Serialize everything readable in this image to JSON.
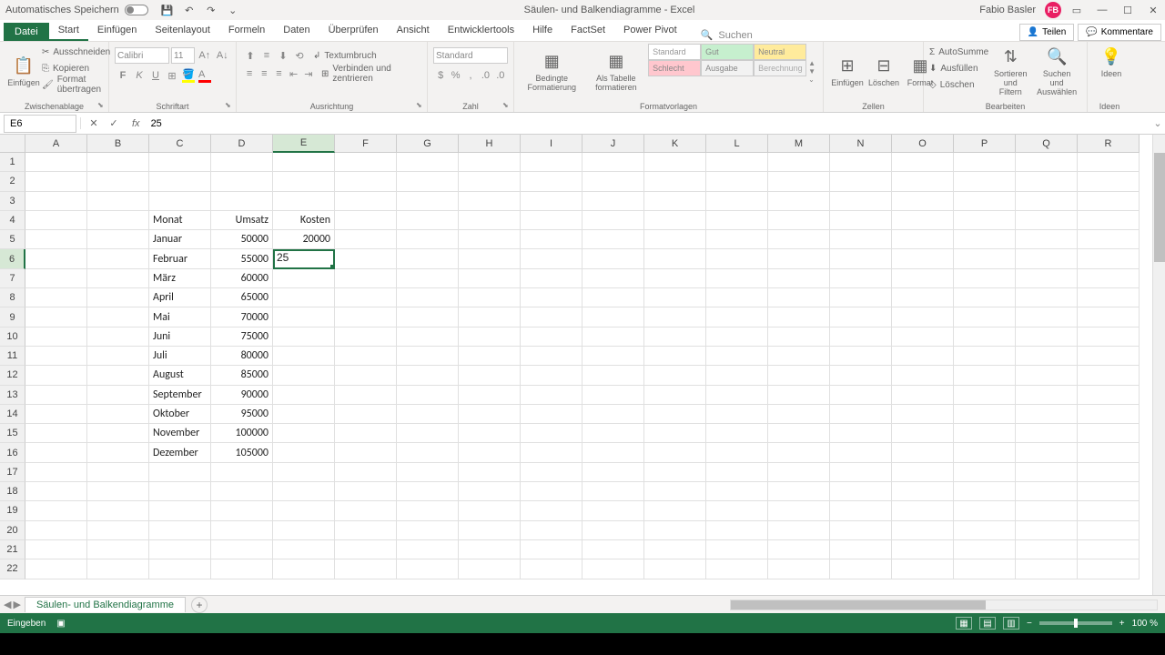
{
  "titlebar": {
    "autosave": "Automatisches Speichern",
    "doc_title": "Säulen- und Balkendiagramme - Excel",
    "user_name": "Fabio Basler",
    "user_initials": "FB"
  },
  "tabs": {
    "file": "Datei",
    "items": [
      "Start",
      "Einfügen",
      "Seitenlayout",
      "Formeln",
      "Daten",
      "Überprüfen",
      "Ansicht",
      "Entwicklertools",
      "Hilfe",
      "FactSet",
      "Power Pivot"
    ],
    "search_placeholder": "Suchen",
    "share": "Teilen",
    "comments": "Kommentare"
  },
  "ribbon": {
    "paste": "Einfügen",
    "cut": "Ausschneiden",
    "copy": "Kopieren",
    "format_painter": "Format übertragen",
    "clipboard": "Zwischenablage",
    "font_name": "Calibri",
    "font_size": "11",
    "font_group": "Schriftart",
    "wrap": "Textumbruch",
    "merge": "Verbinden und zentrieren",
    "align_group": "Ausrichtung",
    "num_format": "Standard",
    "num_group": "Zahl",
    "cond_fmt": "Bedingte Formatierung",
    "as_table": "Als Tabelle formatieren",
    "styles": {
      "standard": "Standard",
      "gut": "Gut",
      "neutral": "Neutral",
      "schlecht": "Schlecht",
      "ausgabe": "Ausgabe",
      "berechnung": "Berechnung"
    },
    "styles_group": "Formatvorlagen",
    "insert": "Einfügen",
    "delete": "Löschen",
    "format": "Format",
    "cells_group": "Zellen",
    "autosum": "AutoSumme",
    "fill": "Ausfüllen",
    "clear": "Löschen",
    "sort": "Sortieren und Filtern",
    "find": "Suchen und Auswählen",
    "edit_group": "Bearbeiten",
    "ideas": "Ideen",
    "ideas_group": "Ideen"
  },
  "formula_bar": {
    "name_box": "E6",
    "value": "25"
  },
  "grid": {
    "columns": [
      "A",
      "B",
      "C",
      "D",
      "E",
      "F",
      "G",
      "H",
      "I",
      "J",
      "K",
      "L",
      "M",
      "N",
      "O",
      "P",
      "Q",
      "R"
    ],
    "active_col": "E",
    "active_row": 6,
    "row_count": 22,
    "data": {
      "C4": "Monat",
      "D4": "Umsatz",
      "E4": "Kosten",
      "C5": "Januar",
      "D5": "50000",
      "E5": "20000",
      "C6": "Februar",
      "D6": "55000",
      "E6": "25",
      "C7": "März",
      "D7": "60000",
      "C8": "April",
      "D8": "65000",
      "C9": "Mai",
      "D9": "70000",
      "C10": "Juni",
      "D10": "75000",
      "C11": "Juli",
      "D11": "80000",
      "C12": "August",
      "D12": "85000",
      "C13": "September",
      "D13": "90000",
      "C14": "Oktober",
      "D14": "95000",
      "C15": "November",
      "D15": "100000",
      "C16": "Dezember",
      "D16": "105000"
    }
  },
  "sheet": {
    "name": "Säulen- und Balkendiagramme"
  },
  "status": {
    "mode": "Eingeben",
    "zoom": "100 %"
  },
  "chart_data": {
    "type": "table",
    "title": "Monat / Umsatz / Kosten",
    "columns": [
      "Monat",
      "Umsatz",
      "Kosten"
    ],
    "rows": [
      [
        "Januar",
        50000,
        20000
      ],
      [
        "Februar",
        55000,
        25
      ],
      [
        "März",
        60000,
        null
      ],
      [
        "April",
        65000,
        null
      ],
      [
        "Mai",
        70000,
        null
      ],
      [
        "Juni",
        75000,
        null
      ],
      [
        "Juli",
        80000,
        null
      ],
      [
        "August",
        85000,
        null
      ],
      [
        "September",
        90000,
        null
      ],
      [
        "Oktober",
        95000,
        null
      ],
      [
        "November",
        100000,
        null
      ],
      [
        "Dezember",
        105000,
        null
      ]
    ]
  }
}
